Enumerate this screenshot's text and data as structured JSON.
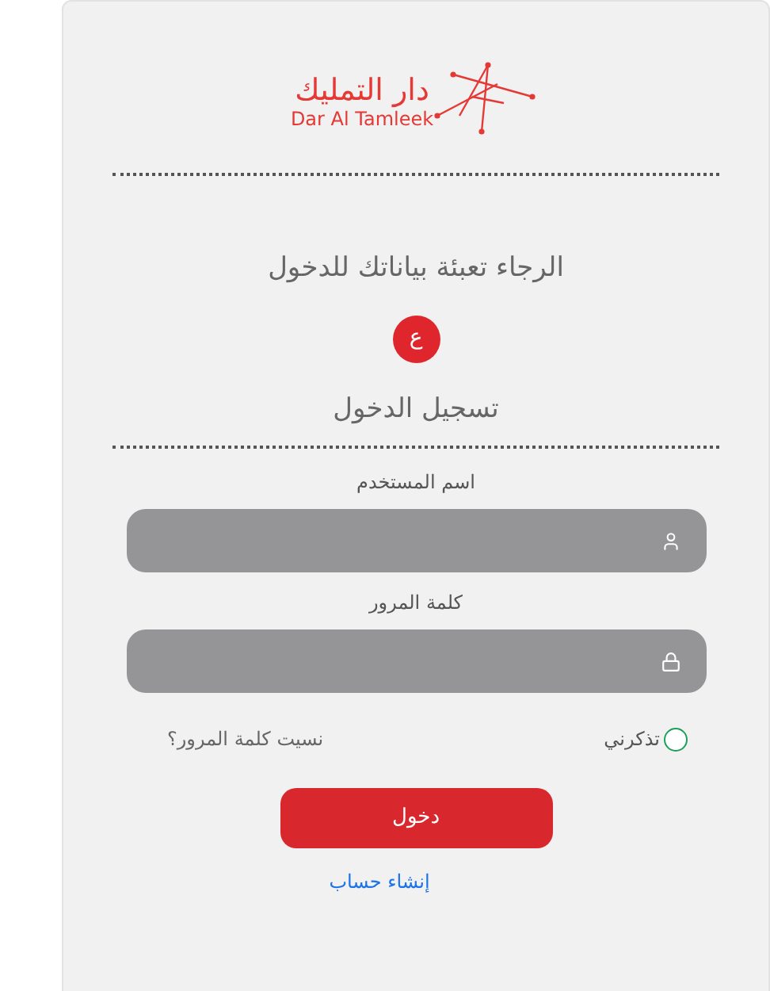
{
  "logo": {
    "arabic_name": "دار التمليك",
    "latin_name": "Dar Al Tamleek"
  },
  "prompt": "الرجاء تعبئة بياناتك للدخول",
  "language_toggle": "ع",
  "form_title": "تسجيل الدخول",
  "fields": [
    {
      "label": "اسم المستخدم",
      "kind": "user"
    },
    {
      "label": "كلمة المرور",
      "kind": "password"
    }
  ],
  "remember_me": {
    "label": "تذكرني",
    "checked": false
  },
  "forgot_password": "نسيت كلمة المرور؟",
  "login_button": "دخول",
  "register_link": "إنشاء حساب"
}
